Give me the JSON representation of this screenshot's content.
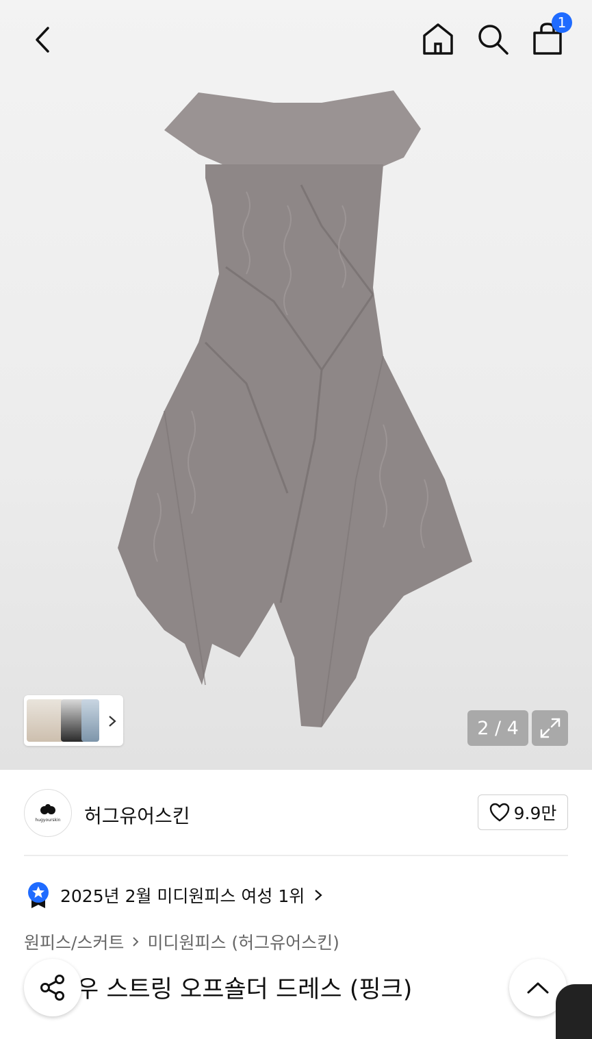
{
  "header": {
    "cart_count": "1"
  },
  "gallery": {
    "counter": "2 / 4"
  },
  "brand": {
    "name": "허그유어스킨",
    "logo_text": "hugyourskin",
    "likes": "9.9만"
  },
  "ranking": {
    "text": "2025년 2월 미디원피스 여성 1위"
  },
  "breadcrumb": {
    "category": "원피스/스커트",
    "subcategory": "미디원피스 (허그유어스킨)"
  },
  "product": {
    "title_visible": "우 스트링 오프숄더 드레스 (핑크)"
  },
  "colors": {
    "accent": "#1f6bff",
    "dress": "#8e8787"
  }
}
